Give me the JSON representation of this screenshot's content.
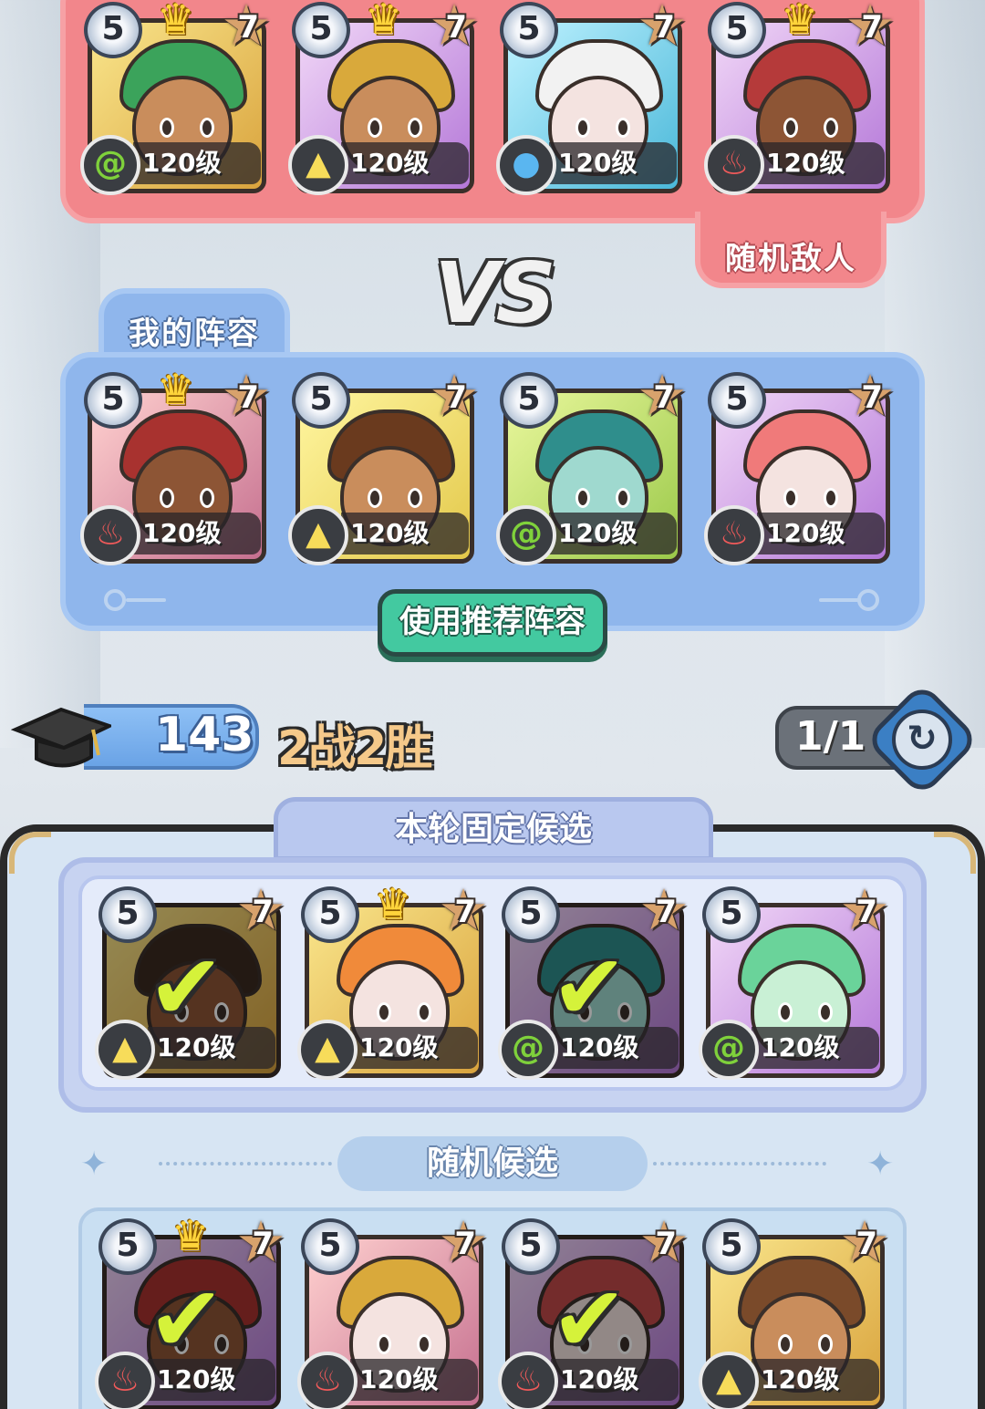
{
  "colors": {
    "enemy": "#f2868b",
    "mine": "#8fb6ec",
    "recommend": "#43c9a0",
    "record": "#f5c98a"
  },
  "enemy_tag": "随机敌人",
  "my_tag": "我的阵容",
  "vs_text": "VS",
  "recommend_button": "使用推荐阵容",
  "score": "143",
  "record": "2战2胜",
  "refresh_count": "1/1",
  "fixed_title": "本轮固定候选",
  "random_title": "随机候选",
  "enemy_team": [
    {
      "rank": "5",
      "stars": "7",
      "level": "120级",
      "element": "nature-icon",
      "crown": true
    },
    {
      "rank": "5",
      "stars": "7",
      "level": "120级",
      "element": "earth-icon",
      "crown": true
    },
    {
      "rank": "5",
      "stars": "7",
      "level": "120级",
      "element": "water-icon",
      "crown": false
    },
    {
      "rank": "5",
      "stars": "7",
      "level": "120级",
      "element": "fire-icon",
      "crown": true
    }
  ],
  "my_team": [
    {
      "rank": "5",
      "stars": "7",
      "level": "120级",
      "element": "fire-icon",
      "crown": true
    },
    {
      "rank": "5",
      "stars": "7",
      "level": "120级",
      "element": "earth-icon",
      "crown": false
    },
    {
      "rank": "5",
      "stars": "7",
      "level": "120级",
      "element": "nature-icon",
      "crown": false
    },
    {
      "rank": "5",
      "stars": "7",
      "level": "120级",
      "element": "fire-icon",
      "crown": false
    }
  ],
  "fixed_candidates": [
    {
      "rank": "5",
      "stars": "7",
      "level": "120级",
      "element": "earth-icon",
      "crown": false,
      "selected": true
    },
    {
      "rank": "5",
      "stars": "7",
      "level": "120级",
      "element": "earth-icon",
      "crown": true,
      "selected": false
    },
    {
      "rank": "5",
      "stars": "7",
      "level": "120级",
      "element": "nature-icon",
      "crown": false,
      "selected": true
    },
    {
      "rank": "5",
      "stars": "7",
      "level": "120级",
      "element": "nature-icon",
      "crown": false,
      "selected": false
    }
  ],
  "random_candidates": [
    {
      "rank": "5",
      "stars": "7",
      "level": "120级",
      "element": "fire-icon",
      "crown": true,
      "selected": true
    },
    {
      "rank": "5",
      "stars": "7",
      "level": "120级",
      "element": "fire-icon",
      "crown": false,
      "selected": false
    },
    {
      "rank": "5",
      "stars": "7",
      "level": "120级",
      "element": "fire-icon",
      "crown": false,
      "selected": true
    },
    {
      "rank": "5",
      "stars": "7",
      "level": "120级",
      "element": "earth-icon",
      "crown": false,
      "selected": false
    }
  ]
}
